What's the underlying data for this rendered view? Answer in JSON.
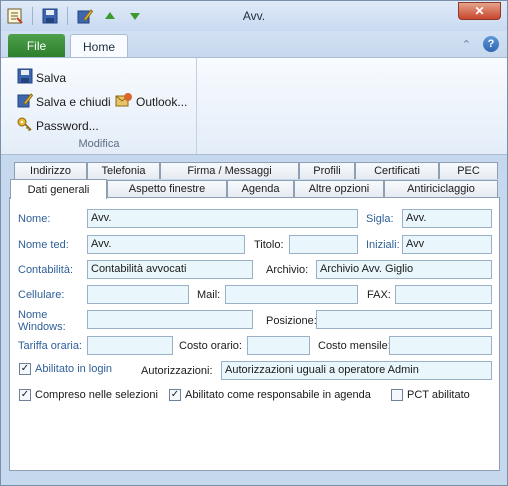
{
  "window": {
    "title": "Avv."
  },
  "colors": {
    "accent": "#2f5f99",
    "file_tab": "#2d7f2d",
    "close": "#c8452c",
    "field_bg": "#e9f6fb"
  },
  "qat": {
    "icons": [
      "app-notepad-icon",
      "save-icon",
      "edit-icon",
      "arrow-up-icon",
      "arrow-down-icon"
    ]
  },
  "ribbon": {
    "tabs": {
      "file": "File",
      "home": "Home"
    },
    "group": {
      "label": "Modifica",
      "save": "Salva",
      "save_close": "Salva e chiudi",
      "outlook": "Outlook...",
      "password": "Password..."
    }
  },
  "dialog": {
    "tabs_back": [
      "Indirizzo",
      "Telefonia",
      "Firma / Messaggi",
      "Profili",
      "Certificati",
      "PEC"
    ],
    "tabs_front": [
      "Dati generali",
      "Aspetto finestre",
      "Agenda",
      "Altre opzioni",
      "Antiriciclaggio"
    ],
    "active_tab": "Dati generali"
  },
  "form": {
    "nome": {
      "label": "Nome:",
      "value": "Avv."
    },
    "sigla": {
      "label": "Sigla:",
      "value": "Avv."
    },
    "nome_ted": {
      "label": "Nome ted:",
      "value": "Avv."
    },
    "titolo": {
      "label": "Titolo:",
      "value": ""
    },
    "iniziali": {
      "label": "Iniziali:",
      "value": "Avv"
    },
    "contabilita": {
      "label": "Contabilità:",
      "value": "Contabilità avvocati"
    },
    "archivio": {
      "label": "Archivio:",
      "value": "Archivio Avv. Giglio"
    },
    "cellulare": {
      "label": "Cellulare:",
      "value": ""
    },
    "mail": {
      "label": "Mail:",
      "value": ""
    },
    "fax": {
      "label": "FAX:",
      "value": ""
    },
    "nome_windows": {
      "label_line1": "Nome",
      "label_line2": "Windows:",
      "value": ""
    },
    "posizione": {
      "label": "Posizione:",
      "value": ""
    },
    "tariffa": {
      "label": "Tariffa oraria:",
      "value": ""
    },
    "costo_orario": {
      "label": "Costo orario:",
      "value": ""
    },
    "costo_mensile": {
      "label": "Costo mensile:",
      "value": ""
    },
    "abilitato_login": {
      "label": "Abilitato in login",
      "checked": true
    },
    "autorizzazioni": {
      "label": "Autorizzazioni:",
      "value": "Autorizzazioni uguali a operatore Admin"
    },
    "compreso": {
      "label": "Compreso nelle selezioni",
      "checked": true
    },
    "responsabile": {
      "label": "Abilitato come responsabile in agenda",
      "checked": true
    },
    "pct": {
      "label": "PCT abilitato",
      "checked": false
    }
  }
}
